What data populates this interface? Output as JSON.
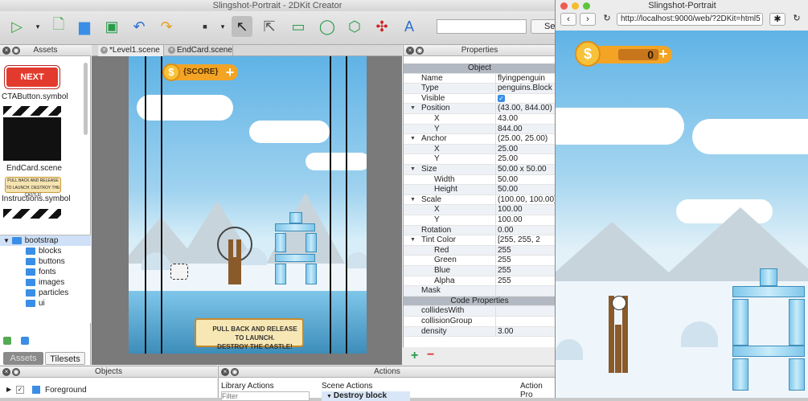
{
  "creator": {
    "title": "Slingshot-Portrait - 2DKit Creator",
    "search_button": "Se"
  },
  "assets": {
    "header": "Assets",
    "items": [
      {
        "label": "CTAButton.symbol",
        "preview_text": "NEXT LEVEL"
      },
      {
        "label": "EndCard.scene"
      },
      {
        "label": "Instructions.symbol",
        "preview_text": "PULL BACK AND RELEASE TO LAUNCH. DESTROY THE CASTLE!"
      }
    ],
    "tree": [
      {
        "label": "bootstrap",
        "level": 0
      },
      {
        "label": "blocks",
        "level": 1
      },
      {
        "label": "buttons",
        "level": 1
      },
      {
        "label": "fonts",
        "level": 1
      },
      {
        "label": "images",
        "level": 1
      },
      {
        "label": "particles",
        "level": 1
      },
      {
        "label": "ui",
        "level": 1
      }
    ],
    "tabs": [
      "Assets",
      "Tilesets"
    ]
  },
  "scene": {
    "tabs": [
      "*Level1.scene",
      "EndCard.scene"
    ],
    "score_label": "{SCORE}",
    "launch_text_1": "PULL BACK AND RELEASE TO LAUNCH.",
    "launch_text_2": "DESTROY THE CASTLE!"
  },
  "properties": {
    "header": "Properties",
    "rows": [
      {
        "k": "Object",
        "v": "",
        "type": "section"
      },
      {
        "k": "Name",
        "v": "flyingpenguin"
      },
      {
        "k": "Type",
        "v": "penguins.Block"
      },
      {
        "k": "Visible",
        "v": "",
        "checkbox": true
      },
      {
        "k": "Position",
        "v": "(43.00, 844.00)",
        "expand": true
      },
      {
        "k": "X",
        "v": "43.00",
        "indent": true
      },
      {
        "k": "Y",
        "v": "844.00",
        "indent": true
      },
      {
        "k": "Anchor",
        "v": "(25.00, 25.00)",
        "expand": true
      },
      {
        "k": "X",
        "v": "25.00",
        "indent": true
      },
      {
        "k": "Y",
        "v": "25.00",
        "indent": true
      },
      {
        "k": "Size",
        "v": "50.00 x 50.00",
        "expand": true
      },
      {
        "k": "Width",
        "v": "50.00",
        "indent": true
      },
      {
        "k": "Height",
        "v": "50.00",
        "indent": true
      },
      {
        "k": "Scale",
        "v": "(100.00, 100.00)",
        "expand": true
      },
      {
        "k": "X",
        "v": "100.00",
        "indent": true
      },
      {
        "k": "Y",
        "v": "100.00",
        "indent": true
      },
      {
        "k": "Rotation",
        "v": "0.00"
      },
      {
        "k": "Tint Color",
        "v": "[255, 255, 2",
        "expand": true
      },
      {
        "k": "Red",
        "v": "255",
        "indent": true
      },
      {
        "k": "Green",
        "v": "255",
        "indent": true
      },
      {
        "k": "Blue",
        "v": "255",
        "indent": true
      },
      {
        "k": "Alpha",
        "v": "255",
        "indent": true
      },
      {
        "k": "Mask",
        "v": ""
      },
      {
        "k": "Code Properties",
        "v": "",
        "type": "section"
      },
      {
        "k": "collidesWith",
        "v": ""
      },
      {
        "k": "collisionGroup",
        "v": ""
      },
      {
        "k": "density",
        "v": "3.00"
      }
    ]
  },
  "objects": {
    "header": "Objects",
    "first_item": "Foreground"
  },
  "actions": {
    "header": "Actions",
    "library_actions": "Library Actions",
    "filter_placeholder": "Filter",
    "scene_actions": "Scene Actions",
    "scene_action_item": "Destroy block",
    "action_props": "Action Pro"
  },
  "browser": {
    "title": "Slingshot-Portrait",
    "url": "http://localhost:9000/web/?2DKit=html5",
    "score": "0"
  }
}
